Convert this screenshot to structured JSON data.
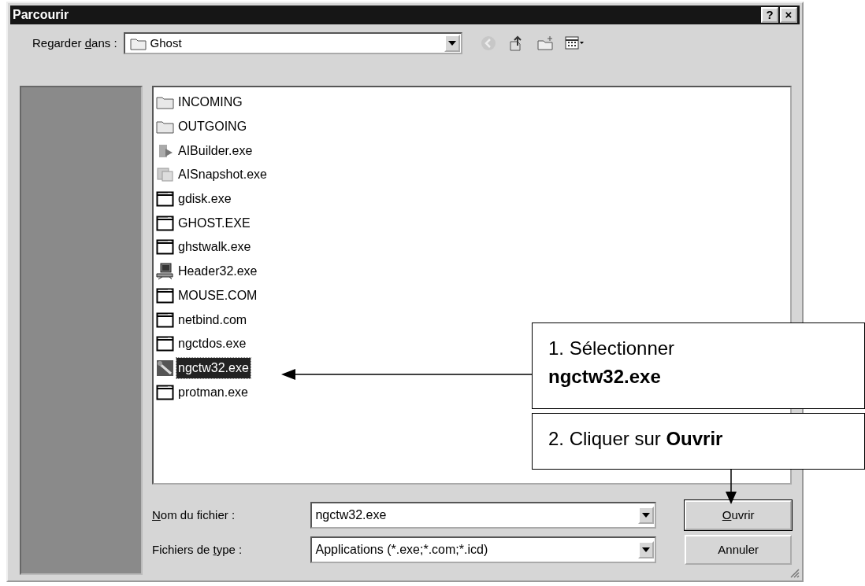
{
  "window": {
    "title": "Parcourir",
    "title_buttons": [
      "?",
      "×"
    ]
  },
  "look_in": {
    "label_parts": [
      {
        "text": "Regarder ",
        "underline": false
      },
      {
        "text": "d",
        "underline": true
      },
      {
        "text": "ans :",
        "underline": false
      }
    ],
    "value": "Ghost"
  },
  "toolbar": [
    {
      "kind": "back",
      "disabled": true
    },
    {
      "kind": "up",
      "disabled": false
    },
    {
      "kind": "new-folder",
      "disabled": false
    },
    {
      "kind": "views",
      "disabled": false
    }
  ],
  "files": [
    {
      "name": "INCOMING",
      "kind": "folder",
      "selected": false
    },
    {
      "name": "OUTGOING",
      "kind": "folder",
      "selected": false
    },
    {
      "name": "AIBuilder.exe",
      "kind": "installer",
      "selected": false
    },
    {
      "name": "AISnapshot.exe",
      "kind": "snapshot",
      "selected": false
    },
    {
      "name": "gdisk.exe",
      "kind": "program",
      "selected": false
    },
    {
      "name": "GHOST.EXE",
      "kind": "program",
      "selected": false
    },
    {
      "name": "ghstwalk.exe",
      "kind": "program",
      "selected": false
    },
    {
      "name": "Header32.exe",
      "kind": "network",
      "selected": false
    },
    {
      "name": "MOUSE.COM",
      "kind": "program",
      "selected": false
    },
    {
      "name": "netbind.com",
      "kind": "program",
      "selected": false
    },
    {
      "name": "ngctdos.exe",
      "kind": "program",
      "selected": false
    },
    {
      "name": "ngctw32.exe",
      "kind": "tool",
      "selected": true
    },
    {
      "name": "protman.exe",
      "kind": "program",
      "selected": false
    }
  ],
  "file_name": {
    "label_parts": [
      {
        "text": "N",
        "underline": true
      },
      {
        "text": "om du fichier :",
        "underline": false
      }
    ],
    "value": "ngctw32.exe"
  },
  "file_type": {
    "label_parts": [
      {
        "text": "Fichiers de ",
        "underline": false
      },
      {
        "text": "t",
        "underline": true
      },
      {
        "text": "ype :",
        "underline": false
      }
    ],
    "value": "Applications (*.exe;*.com;*.icd)"
  },
  "buttons": [
    {
      "label_parts": [
        {
          "text": "O",
          "underline": true
        },
        {
          "text": "uvrir",
          "underline": false
        }
      ],
      "default": true
    },
    {
      "label_parts": [
        {
          "text": "Annuler",
          "underline": false
        }
      ],
      "default": false
    }
  ],
  "callouts": [
    {
      "text": "1. Sélectionner **ngctw32.exe**"
    },
    {
      "text": "2. Cliquer sur **Ouvrir**"
    }
  ]
}
